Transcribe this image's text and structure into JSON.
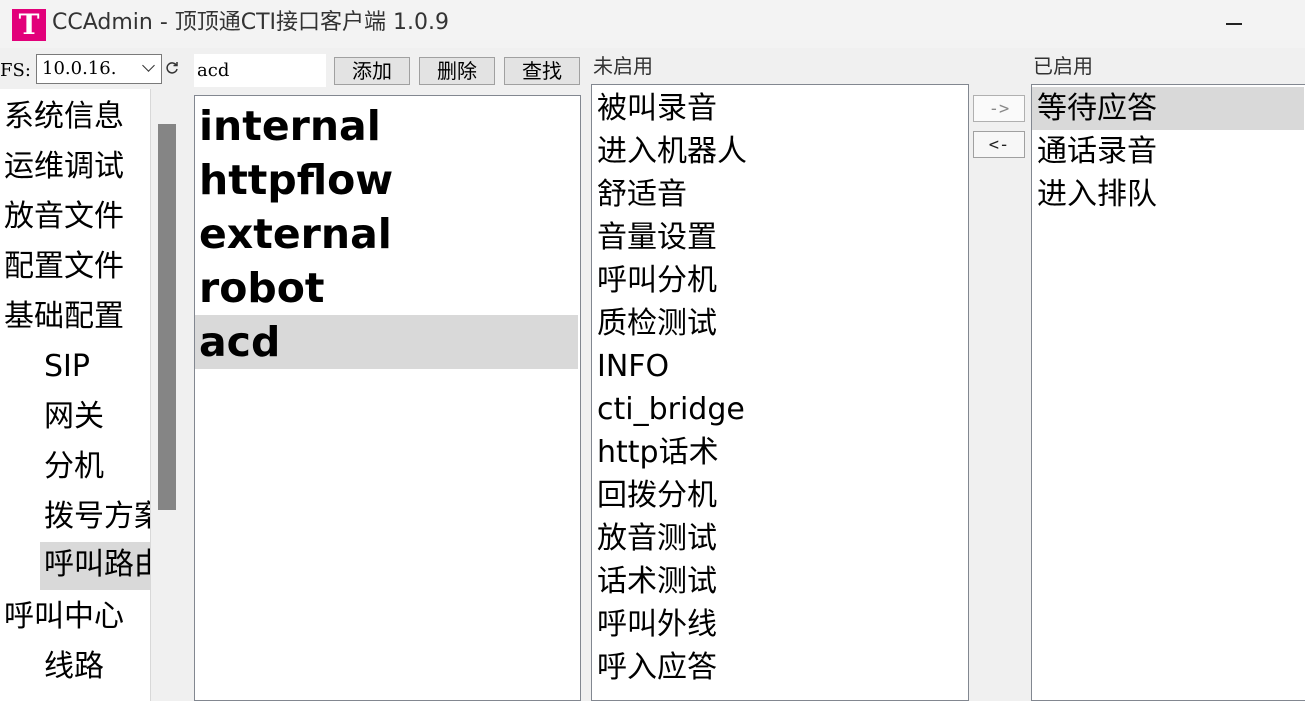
{
  "window": {
    "title": "CCAdmin - 顶顶通CTI接口客户端 1.0.9",
    "logo_letter": "T"
  },
  "toolbar": {
    "fs_label": "FS:",
    "fs_value": "10.0.16.",
    "search_value": "acd",
    "add_label": "添加",
    "delete_label": "删除",
    "find_label": "查找"
  },
  "nav": {
    "items": [
      {
        "label": "系统信息"
      },
      {
        "label": "运维调试"
      },
      {
        "label": "放音文件"
      },
      {
        "label": "配置文件"
      },
      {
        "label": "基础配置"
      },
      {
        "label": "SIP"
      },
      {
        "label": "网关"
      },
      {
        "label": "分机"
      },
      {
        "label": "拨号方案"
      },
      {
        "label": "呼叫路由",
        "selected": true
      },
      {
        "label": "呼叫中心"
      },
      {
        "label": "线路"
      }
    ]
  },
  "flows": {
    "items": [
      "internal",
      "httpflow",
      "external",
      "robot",
      "acd"
    ],
    "selected": "acd"
  },
  "disabled": {
    "label": "未启用",
    "items": [
      "被叫录音",
      "进入机器人",
      "舒适音",
      "音量设置",
      "呼叫分机",
      "质检测试",
      "INFO",
      "cti_bridge",
      "http话术",
      "回拨分机",
      "放音测试",
      "话术测试",
      "呼叫外线",
      "呼入应答"
    ]
  },
  "enabled": {
    "label": "已启用",
    "items": [
      "等待应答",
      "通话录音",
      "进入排队"
    ],
    "selected": "等待应答"
  },
  "actions": {
    "move_right_label": "->",
    "move_left_label": "<-"
  }
}
